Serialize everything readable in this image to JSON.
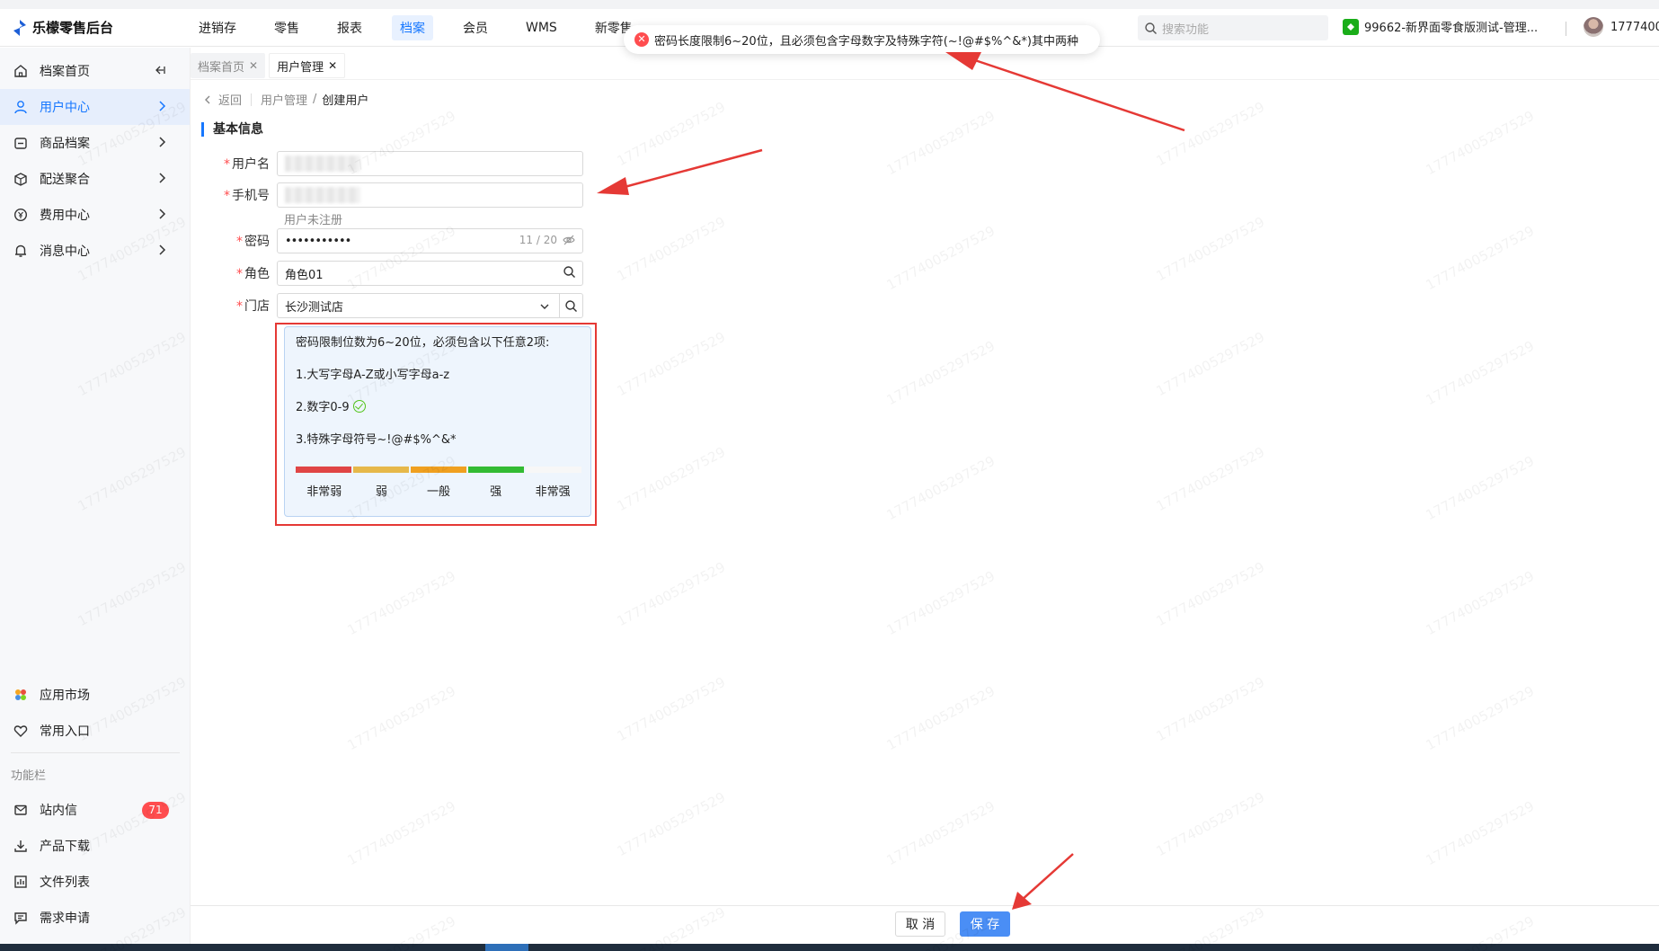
{
  "app": {
    "title": "乐檬零售后台"
  },
  "topnav": [
    {
      "label": "进销存",
      "active": false
    },
    {
      "label": "零售",
      "active": false
    },
    {
      "label": "报表",
      "active": false
    },
    {
      "label": "档案",
      "active": true
    },
    {
      "label": "会员",
      "active": false
    },
    {
      "label": "WMS",
      "active": false
    },
    {
      "label": "新零售",
      "active": false
    }
  ],
  "header": {
    "search_placeholder": "搜索功能",
    "store_name": "99662-新界面零食版测试-管理...",
    "user": "1777400"
  },
  "toast": {
    "message": "密码长度限制6~20位，且必须包含字母数字及特殊字符(~!@#$%^&*)其中两种"
  },
  "sidebar": {
    "items": [
      {
        "label": "档案首页",
        "icon": "home-icon"
      },
      {
        "label": "用户中心",
        "icon": "user-icon"
      },
      {
        "label": "商品档案",
        "icon": "goods-icon"
      },
      {
        "label": "配送聚合",
        "icon": "delivery-icon"
      },
      {
        "label": "费用中心",
        "icon": "fee-icon"
      },
      {
        "label": "消息中心",
        "icon": "bell-icon"
      }
    ],
    "bottom_items": [
      {
        "label": "应用市场",
        "icon": "app-market-icon"
      },
      {
        "label": "常用入口",
        "icon": "heart-icon"
      }
    ],
    "section_label": "功能栏",
    "function_items": [
      {
        "label": "站内信",
        "icon": "mail-icon",
        "badge": "71"
      },
      {
        "label": "产品下载",
        "icon": "download-icon"
      },
      {
        "label": "文件列表",
        "icon": "file-list-icon"
      },
      {
        "label": "需求申请",
        "icon": "request-icon"
      }
    ]
  },
  "tabs": [
    {
      "label": "档案首页",
      "active": false
    },
    {
      "label": "用户管理",
      "active": true
    }
  ],
  "breadcrumb": {
    "back": "返回",
    "parent": "用户管理",
    "sep": "/",
    "current": "创建用户"
  },
  "form": {
    "section_title": "基本信息",
    "username_label": "用户名",
    "phone_label": "手机号",
    "phone_hint": "用户未注册",
    "password_label": "密码",
    "password_value": "•••••••••••",
    "password_count": "11 / 20",
    "role_label": "角色",
    "role_value": "角色01",
    "store_label": "门店",
    "store_value": "长沙测试店"
  },
  "password_tip": {
    "title": "密码限制位数为6~20位，必须包含以下任意2项:",
    "rule1": "1.大写字母A-Z或小写字母a-z",
    "rule2": "2.数字0-9",
    "rule3": "3.特殊字母符号~!@#$%^&*",
    "rule2_satisfied": true,
    "strength_levels": [
      "非常弱",
      "弱",
      "一般",
      "强",
      "非常强"
    ],
    "strength_colors": [
      "#e04545",
      "#e6b84a",
      "#f0a020",
      "#33bb33",
      "#f7f7f7"
    ]
  },
  "footer": {
    "cancel": "取 消",
    "save": "保 存"
  },
  "watermark": "17774005297529",
  "colors": {
    "primary": "#1677ff",
    "annotation": "#e53935"
  }
}
